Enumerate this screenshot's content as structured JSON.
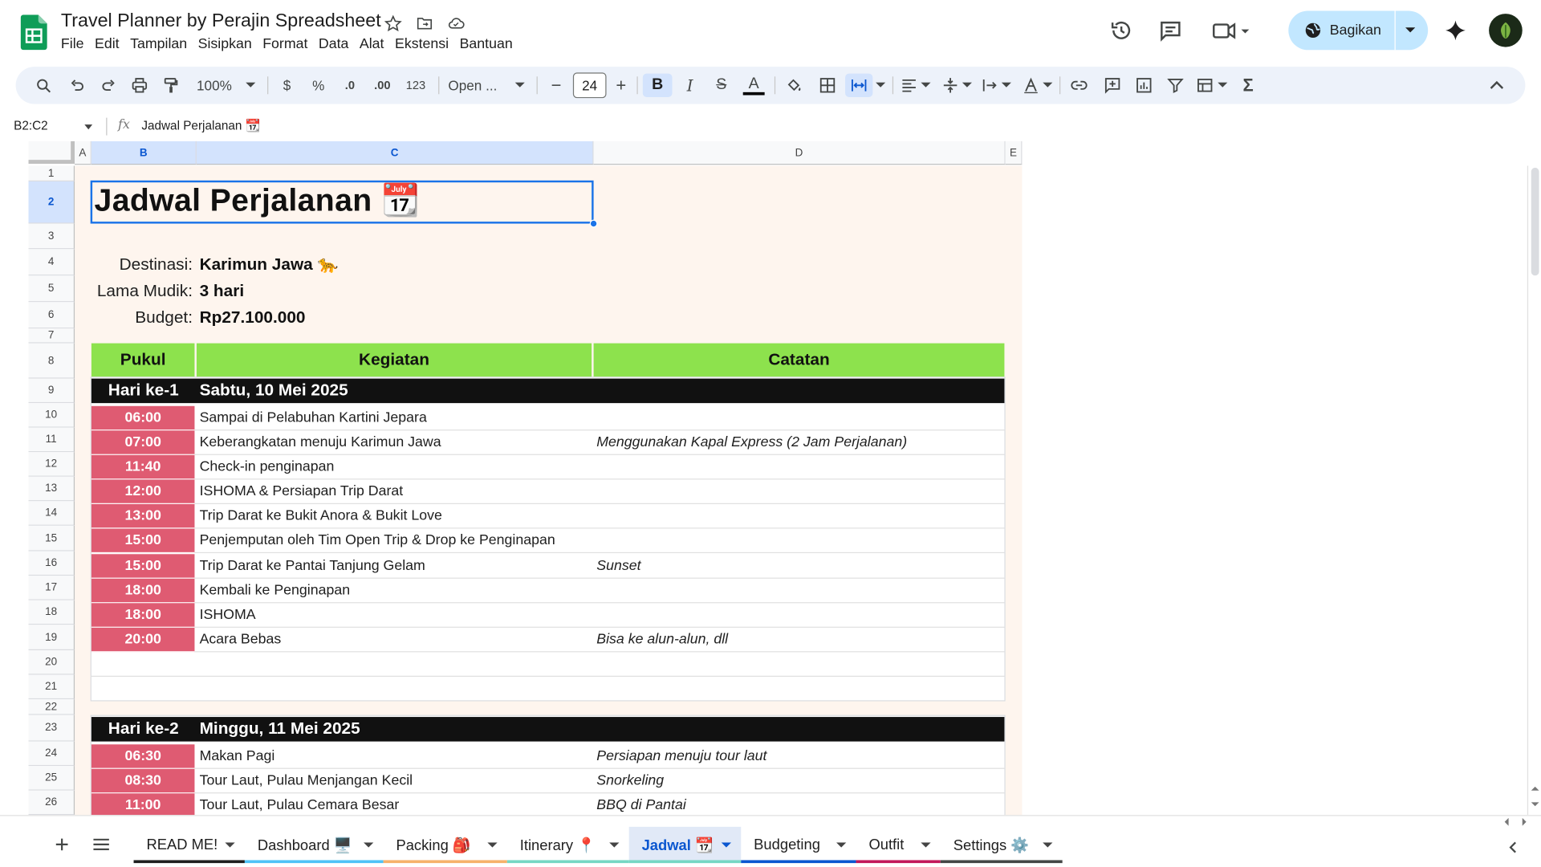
{
  "app": {
    "doc_title": "Travel Planner by Perajin Spreadsheet",
    "menu": [
      "File",
      "Edit",
      "Tampilan",
      "Sisipkan",
      "Format",
      "Data",
      "Alat",
      "Ekstensi",
      "Bantuan"
    ],
    "share_label": "Bagikan",
    "brand_color": "#0f9d58",
    "share_color": "#c2e7ff"
  },
  "toolbar": {
    "zoom": "100%",
    "currency": "$",
    "percent": "%",
    "dec_decrease": ".0",
    "dec_increase": ".00",
    "number_format": "123",
    "font": "Open ...",
    "minus": "−",
    "font_size": "24",
    "plus": "+",
    "bold": "B",
    "italic": "I",
    "strike": "S",
    "text_color": "A",
    "sigma": "Σ"
  },
  "formula": {
    "cell_ref": "B2:C2",
    "fx": "fx",
    "value": "Jadwal Perjalanan 📆"
  },
  "grid": {
    "columns": [
      "A",
      "B",
      "C",
      "D",
      "E"
    ],
    "selected_columns": [
      "B",
      "C"
    ],
    "rows": [
      "1",
      "2",
      "3",
      "4",
      "5",
      "6",
      "7",
      "8",
      "9",
      "10",
      "11",
      "12",
      "13",
      "14",
      "15",
      "16",
      "17",
      "18",
      "19",
      "20",
      "21",
      "22",
      "23",
      "24",
      "25",
      "26"
    ],
    "selected_row": "2"
  },
  "sheet": {
    "title": "Jadwal Perjalanan 📆",
    "info": [
      {
        "label": "Destinasi:",
        "value": "Karimun Jawa 🐆"
      },
      {
        "label": "Lama Mudik:",
        "value": "3 hari"
      },
      {
        "label": "Budget:",
        "value": "Rp27.100.000"
      }
    ],
    "headers": {
      "pukul": "Pukul",
      "kegiatan": "Kegiatan",
      "catatan": "Catatan"
    },
    "header_color": "#8de24d",
    "time_color": "#df5b72",
    "days": [
      {
        "label": "Hari ke-1",
        "date": "Sabtu, 10 Mei 2025",
        "items": [
          {
            "time": "06:00",
            "activity": "Sampai di Pelabuhan Kartini Jepara",
            "note": ""
          },
          {
            "time": "07:00",
            "activity": "Keberangkatan menuju Karimun Jawa",
            "note": "Menggunakan Kapal Express (2 Jam Perjalanan)"
          },
          {
            "time": "11:40",
            "activity": "Check-in penginapan",
            "note": ""
          },
          {
            "time": "12:00",
            "activity": "ISHOMA & Persiapan Trip Darat",
            "note": ""
          },
          {
            "time": "13:00",
            "activity": "Trip Darat ke Bukit Anora & Bukit Love",
            "note": ""
          },
          {
            "time": "15:00",
            "activity": "Penjemputan oleh Tim Open Trip & Drop ke Penginapan",
            "note": ""
          },
          {
            "time": "15:00",
            "activity": "Trip Darat ke Pantai Tanjung Gelam",
            "note": "Sunset"
          },
          {
            "time": "18:00",
            "activity": "Kembali ke Penginapan",
            "note": ""
          },
          {
            "time": "18:00",
            "activity": "ISHOMA",
            "note": ""
          },
          {
            "time": "20:00",
            "activity": "Acara Bebas",
            "note": "Bisa ke alun-alun, dll"
          }
        ]
      },
      {
        "label": "Hari ke-2",
        "date": "Minggu, 11 Mei 2025",
        "items": [
          {
            "time": "06:30",
            "activity": "Makan Pagi",
            "note": "Persiapan menuju tour laut"
          },
          {
            "time": "08:30",
            "activity": "Tour Laut, Pulau Menjangan Kecil",
            "note": "Snorkeling"
          },
          {
            "time": "11:00",
            "activity": "Tour Laut, Pulau Cemara Besar",
            "note": "BBQ di Pantai"
          }
        ]
      }
    ]
  },
  "tabs": [
    {
      "label": "READ ME!",
      "color": "#1f1f1f"
    },
    {
      "label": "Dashboard 🖥️",
      "color": "#4fc3f7"
    },
    {
      "label": "Packing 🎒",
      "color": "#f6b26b"
    },
    {
      "label": "Itinerary 📍",
      "color": "#76d7c4"
    },
    {
      "label": "Jadwal 📆",
      "color": "#76d7c4",
      "active": true
    },
    {
      "label": "Budgeting",
      "color": "#0b57d0"
    },
    {
      "label": "Outfit",
      "color": "#c2185b"
    },
    {
      "label": "Settings ⚙️",
      "color": "#444746"
    }
  ]
}
